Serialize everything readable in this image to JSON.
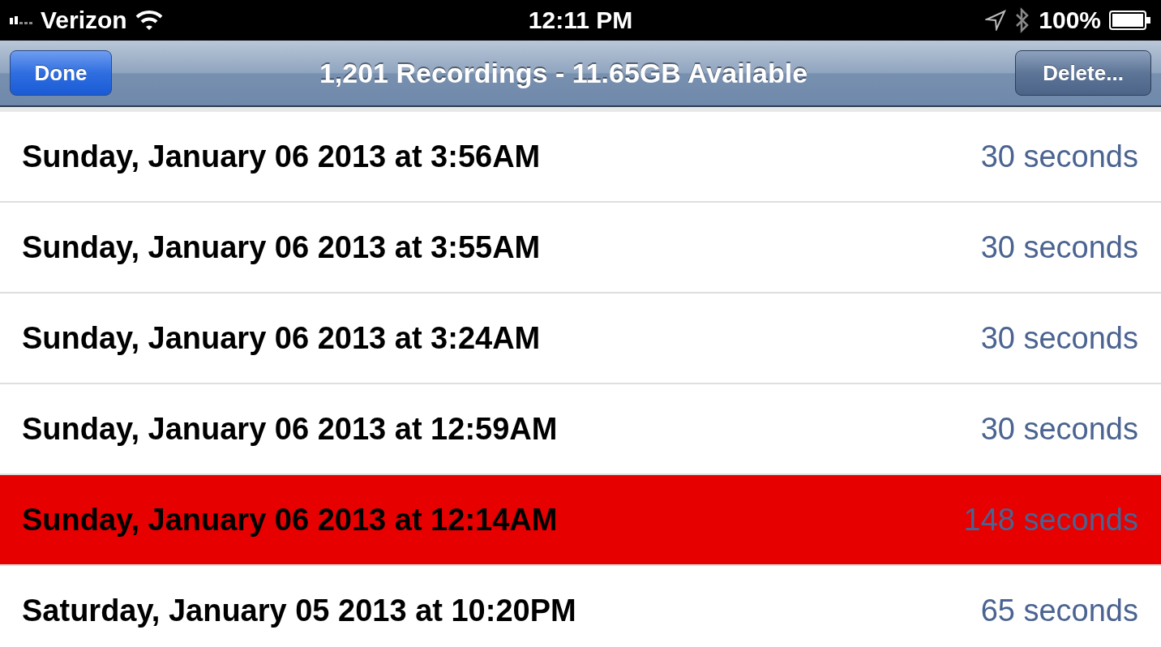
{
  "status_bar": {
    "carrier": "Verizon",
    "time": "12:11 PM",
    "battery": "100%"
  },
  "nav_bar": {
    "left_button": "Done",
    "title": "1,201 Recordings - 11.65GB Available",
    "right_button": "Delete..."
  },
  "recordings": [
    {
      "date": "Sunday, January 06 2013 at 3:56AM",
      "duration": "30 seconds",
      "selected": false
    },
    {
      "date": "Sunday, January 06 2013 at 3:55AM",
      "duration": "30 seconds",
      "selected": false
    },
    {
      "date": "Sunday, January 06 2013 at 3:24AM",
      "duration": "30 seconds",
      "selected": false
    },
    {
      "date": "Sunday, January 06 2013 at 12:59AM",
      "duration": "30 seconds",
      "selected": false
    },
    {
      "date": "Sunday, January 06 2013 at 12:14AM",
      "duration": "148 seconds",
      "selected": true
    },
    {
      "date": "Saturday, January 05 2013 at 10:20PM",
      "duration": "65 seconds",
      "selected": false
    }
  ]
}
